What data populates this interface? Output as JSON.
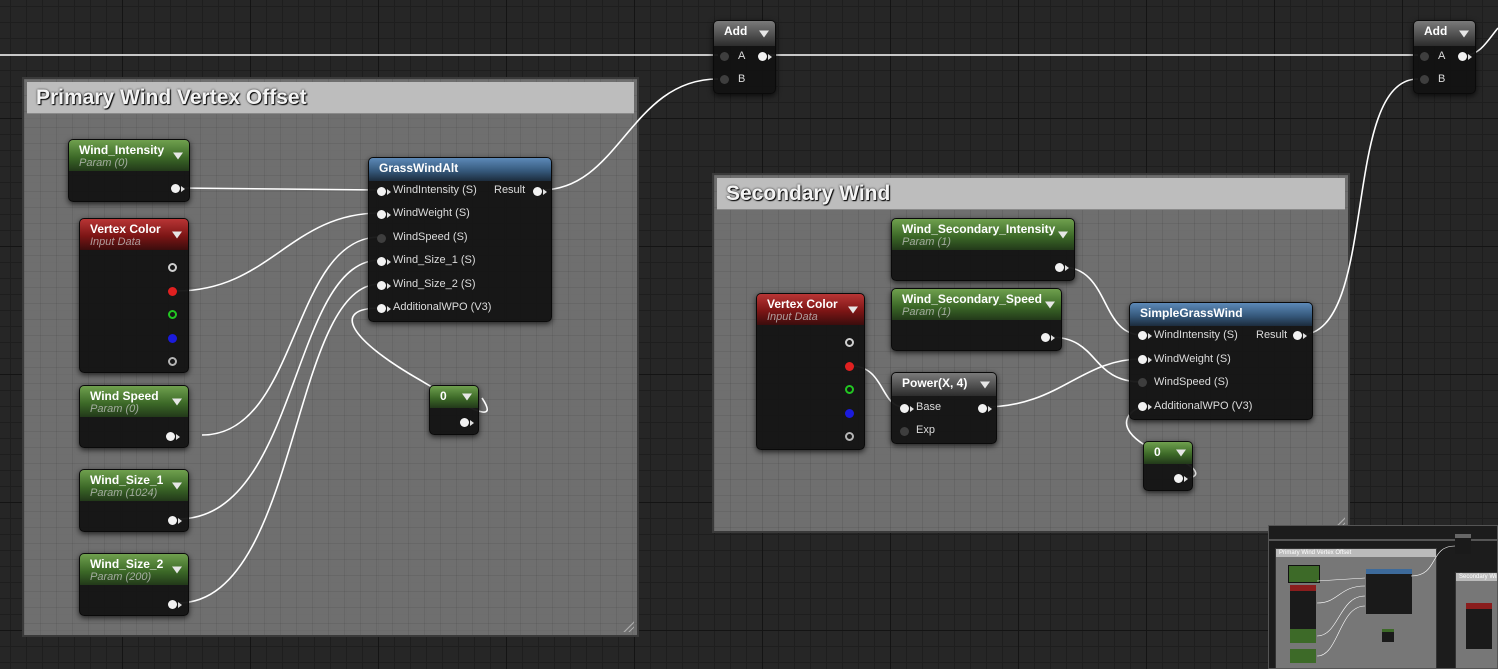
{
  "comments": {
    "primary": "Primary Wind Vertex Offset",
    "secondary": "Secondary Wind"
  },
  "nodes": {
    "add1": {
      "title": "Add",
      "a": "A",
      "b": "B"
    },
    "add2": {
      "title": "Add",
      "a": "A",
      "b": "B"
    },
    "wind_intensity": {
      "title": "Wind_Intensity",
      "sub": "Param (0)"
    },
    "vertex_color_1": {
      "title": "Vertex Color",
      "sub": "Input Data"
    },
    "wind_speed": {
      "title": "Wind Speed",
      "sub": "Param (0)"
    },
    "wind_size_1": {
      "title": "Wind_Size_1",
      "sub": "Param (1024)"
    },
    "wind_size_2": {
      "title": "Wind_Size_2",
      "sub": "Param (200)"
    },
    "grass_wind_alt": {
      "title": "GrassWindAlt",
      "inputs": [
        "WindIntensity (S)",
        "WindWeight (S)",
        "WindSpeed (S)",
        "Wind_Size_1 (S)",
        "Wind_Size_2 (S)",
        "AdditionalWPO (V3)"
      ],
      "output": "Result"
    },
    "const_1": {
      "title": "0"
    },
    "wind_sec_intensity": {
      "title": "Wind_Secondary_Intensity",
      "sub": "Param (1)"
    },
    "wind_sec_speed": {
      "title": "Wind_Secondary_Speed",
      "sub": "Param (1)"
    },
    "vertex_color_2": {
      "title": "Vertex Color",
      "sub": "Input Data"
    },
    "power": {
      "title": "Power(X, 4)",
      "base": "Base",
      "exp": "Exp"
    },
    "simple_grass_wind": {
      "title": "SimpleGrassWind",
      "inputs": [
        "WindIntensity (S)",
        "WindWeight (S)",
        "WindSpeed (S)",
        "AdditionalWPO (V3)"
      ],
      "output": "Result"
    },
    "const_2": {
      "title": "0"
    }
  },
  "minimap": {
    "primary": "Primary Wind Vertex Offset",
    "secondary": "Secondary Wind",
    "add": "Add",
    "grass": "GrassWindAlt"
  },
  "colors": {
    "param_header": "#3d6a28",
    "input_header": "#7c1515",
    "function_header": "#365a7d",
    "math_header": "#505050",
    "wire": "#ffffff"
  }
}
